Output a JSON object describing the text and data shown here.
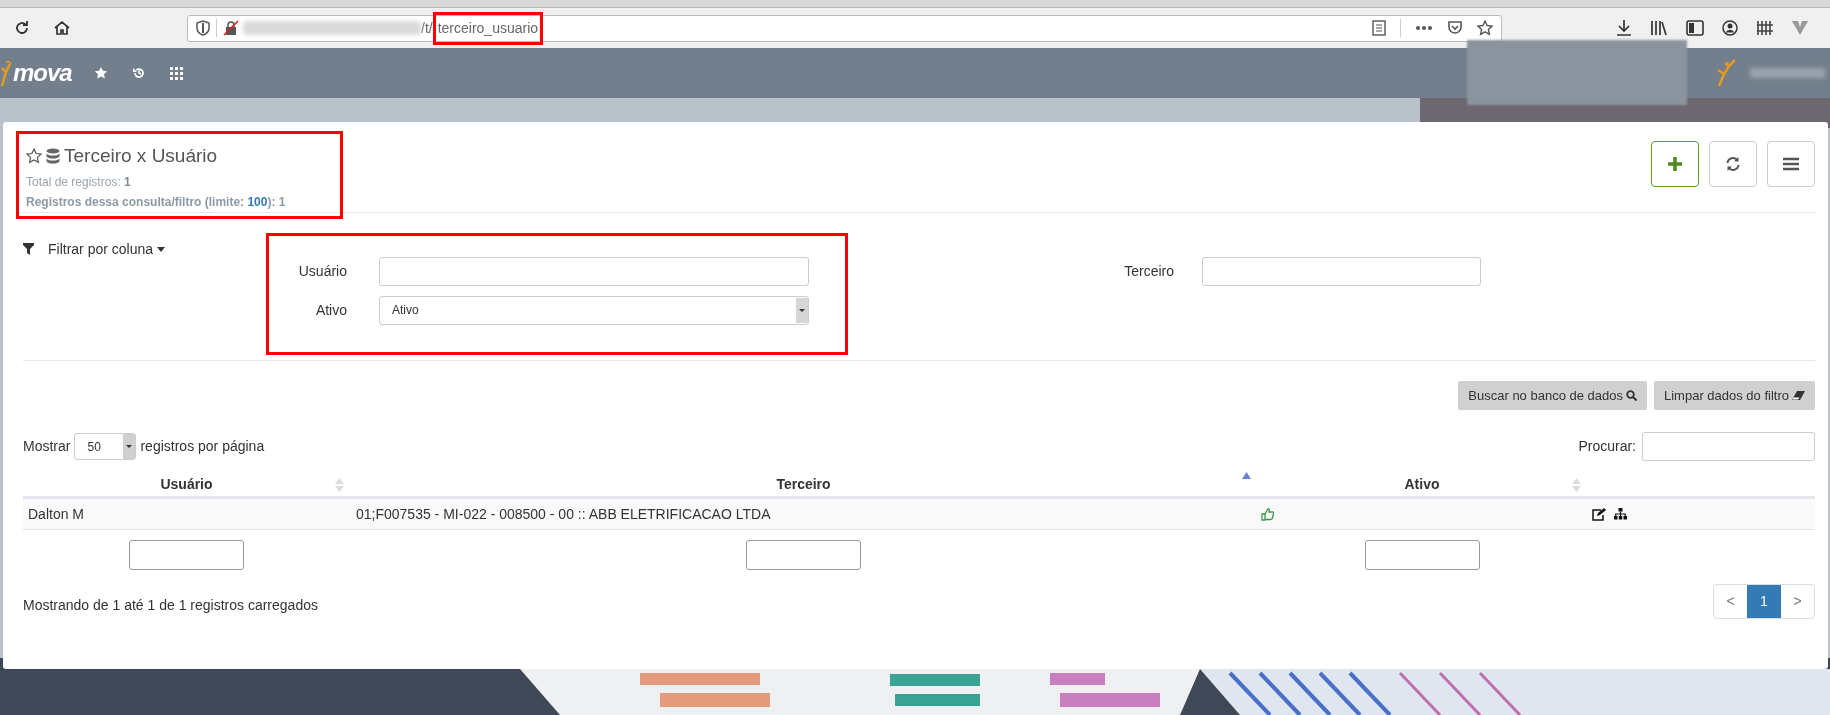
{
  "browser": {
    "url_prefix": "/t/",
    "url_page": "terceiro_usuario",
    "url_highlighted": true
  },
  "app_header": {
    "logo": "mova"
  },
  "page": {
    "title": "Terceiro x Usuário",
    "favorite": false,
    "highlighted": true,
    "total": "Total de registros: **1**",
    "query_before": "Registros dessa consulta/filtro (limite: ",
    "query_limit": "100",
    "query_after": "): 1"
  },
  "toolbar": [
    {
      "kind": "add"
    },
    {
      "kind": "refresh"
    },
    {
      "kind": "menu"
    }
  ],
  "filter": {
    "toggle_label": "Filtrar por coluna",
    "highlighted": true,
    "fields": [
      {
        "kind": "text",
        "label": "Usuário"
      },
      {
        "kind": "select",
        "label": "Ativo",
        "value": "Ativo"
      }
    ],
    "side_fields": [
      {
        "kind": "text",
        "label": "Terceiro"
      }
    ]
  },
  "filter_actions": [
    {
      "label": "Buscar no banco de dados",
      "kind": "search"
    },
    {
      "label": "Limpar dados do filtro",
      "kind": "clear"
    }
  ],
  "table": {
    "length_before": "Mostrar",
    "page_length": "50",
    "length_after": "registros por página",
    "search_label": "Procurar:",
    "columns": [
      {
        "label": "Usuário",
        "sorted": false
      },
      {
        "label": "Terceiro",
        "sorted": true
      },
      {
        "label": "Ativo",
        "sorted": false
      }
    ],
    "rows": [
      {
        "usuario": "Dalton M",
        "terceiro": "01;F007535 - MI-022 - 008500 - 00 :: ABB ELETRIFICACAO LTDA",
        "ativo": true
      }
    ],
    "info": "Mostrando de 1 até 1 de 1 registros carregados",
    "pagination": {
      "prev": "<",
      "pages": [
        {
          "label": "1",
          "selected": true
        }
      ],
      "next": ">"
    }
  }
}
